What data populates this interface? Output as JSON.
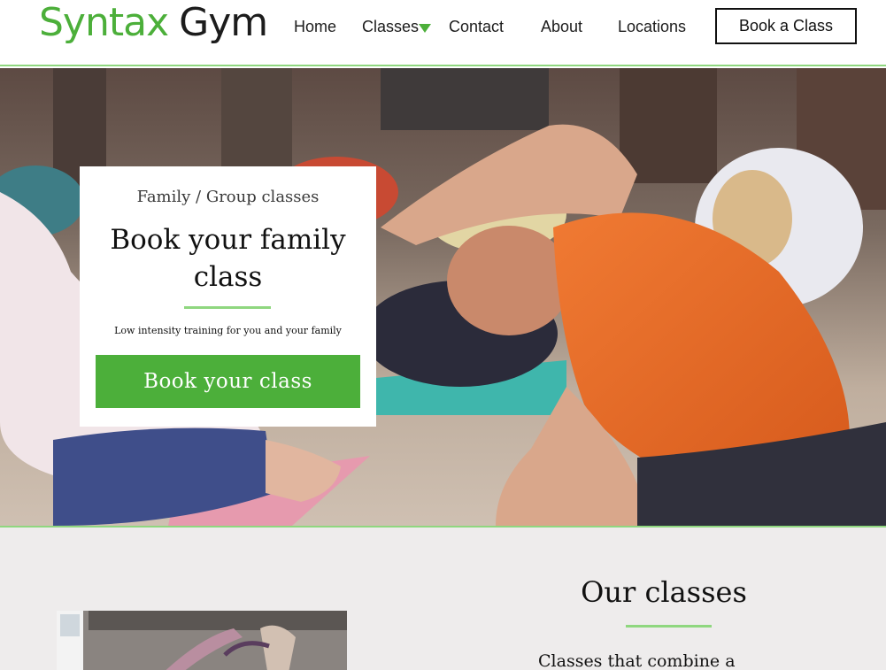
{
  "header": {
    "logo_brand": "Syntax",
    "logo_gym": "Gym",
    "nav": [
      "Home",
      "Classes",
      "Contact",
      "About",
      "Locations"
    ],
    "book_button": "Book a Class",
    "colors": {
      "accent": "#4caf3a",
      "rule": "#8fd77f"
    }
  },
  "hero": {
    "kicker": "Family / Group classes",
    "title": "Book your family class",
    "subtitle": "Low intensity training for you and your family",
    "cta": "Book your class",
    "image": "people stretching on yoga mats"
  },
  "classes": {
    "heading": "Our classes",
    "text": "Classes that combine a"
  }
}
